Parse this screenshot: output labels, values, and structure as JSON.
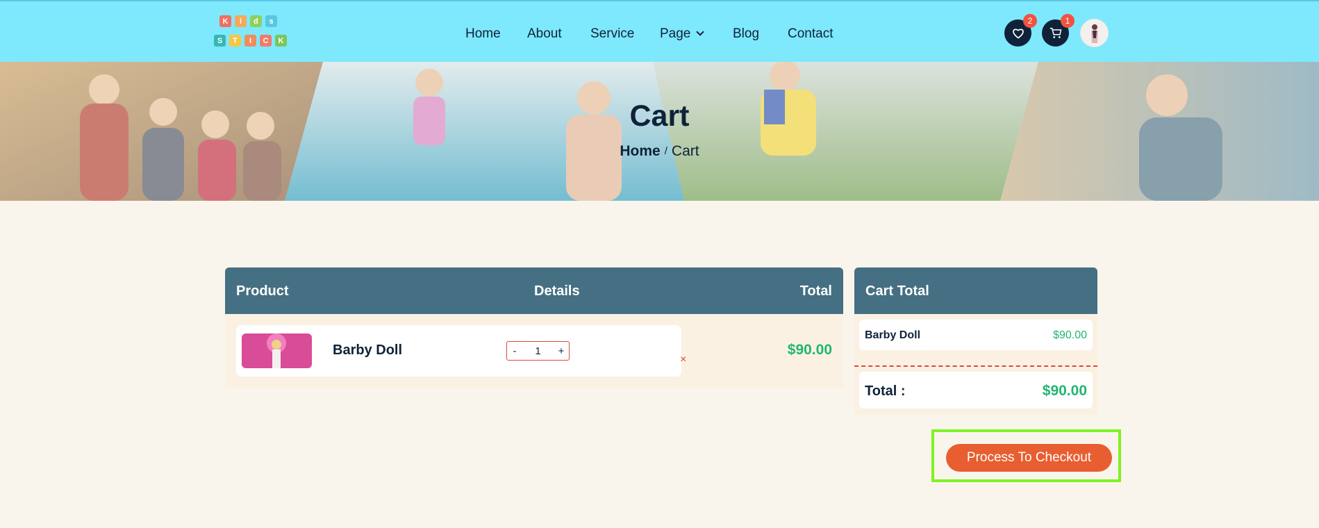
{
  "brand": {
    "logo_row1": [
      "K",
      "i",
      "d",
      "s"
    ],
    "logo_row2": [
      "S",
      "T",
      "I",
      "C",
      "K"
    ],
    "logo_colors": [
      "#f06f60",
      "#f6a85a",
      "#8fd05d",
      "#58c7df",
      "#f7c645",
      "#37b7b4",
      "#f08d5a",
      "#7bc55c",
      "#f07a6a"
    ]
  },
  "nav": {
    "items": [
      "Home",
      "About",
      "Service",
      "Page",
      "Blog",
      "Contact"
    ]
  },
  "header_icons": {
    "wishlist_icon": "heart-icon",
    "wishlist_count": "2",
    "cart_icon": "cart-icon",
    "cart_count": "1"
  },
  "banner": {
    "title": "Cart",
    "breadcrumb_home": "Home",
    "breadcrumb_sep": "/",
    "breadcrumb_current": "Cart"
  },
  "cart_table": {
    "headers": {
      "product": "Product",
      "details": "Details",
      "total": "Total"
    },
    "items": [
      {
        "name": "Barby Doll",
        "qty_minus": "-",
        "qty": "1",
        "qty_plus": "+",
        "remove": "×",
        "total": "$90.00"
      }
    ]
  },
  "cart_total": {
    "header": "Cart Total",
    "lines": [
      {
        "name": "Barby Doll",
        "value": "$90.00"
      }
    ],
    "total_label": "Total :",
    "total_value": "$90.00",
    "checkout_label": "Process To Checkout"
  },
  "colors": {
    "header_bg": "#7ee8fd",
    "table_header": "#456f82",
    "accent_price": "#22b573",
    "checkout_bg": "#e85e30",
    "highlight": "#7ff322"
  }
}
